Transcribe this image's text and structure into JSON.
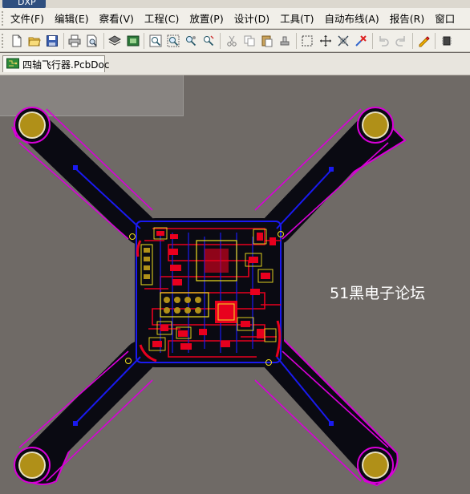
{
  "titlebar": {
    "app_icon": "altium-app-icon",
    "text": "DXP"
  },
  "menu": {
    "items": [
      "文件(F)",
      "编辑(E)",
      "察看(V)",
      "工程(C)",
      "放置(P)",
      "设计(D)",
      "工具(T)",
      "自动布线(A)",
      "报告(R)",
      "窗口"
    ]
  },
  "toolbar": {
    "icons": [
      "new-file-icon",
      "open-folder-icon",
      "save-icon",
      "print-icon",
      "print-preview-icon",
      "layers-icon",
      "3d-view-icon",
      "zoom-fit-icon",
      "zoom-area-icon",
      "zoom-selected-icon",
      "select-net-icon",
      "cut-icon",
      "copy-icon",
      "paste-icon",
      "rubber-stamp-icon",
      "select-rect-icon",
      "move-icon",
      "cross-select-icon",
      "clear-icon",
      "undo-icon",
      "redo-icon",
      "highlighter-icon",
      "component-icon"
    ]
  },
  "document_tab": {
    "label": "四轴飞行器.PcbDoc",
    "icon": "pcb-doc-icon"
  },
  "canvas": {
    "watermark": "51黑电子论坛",
    "colors": {
      "background": "#6f6a66",
      "board": "#0a0a12",
      "outline": "#d800d8",
      "top_layer": "#e8001e",
      "bottom_layer": "#1a1af0",
      "pad": "#b09018",
      "silkscreen": "#f0e020"
    }
  }
}
